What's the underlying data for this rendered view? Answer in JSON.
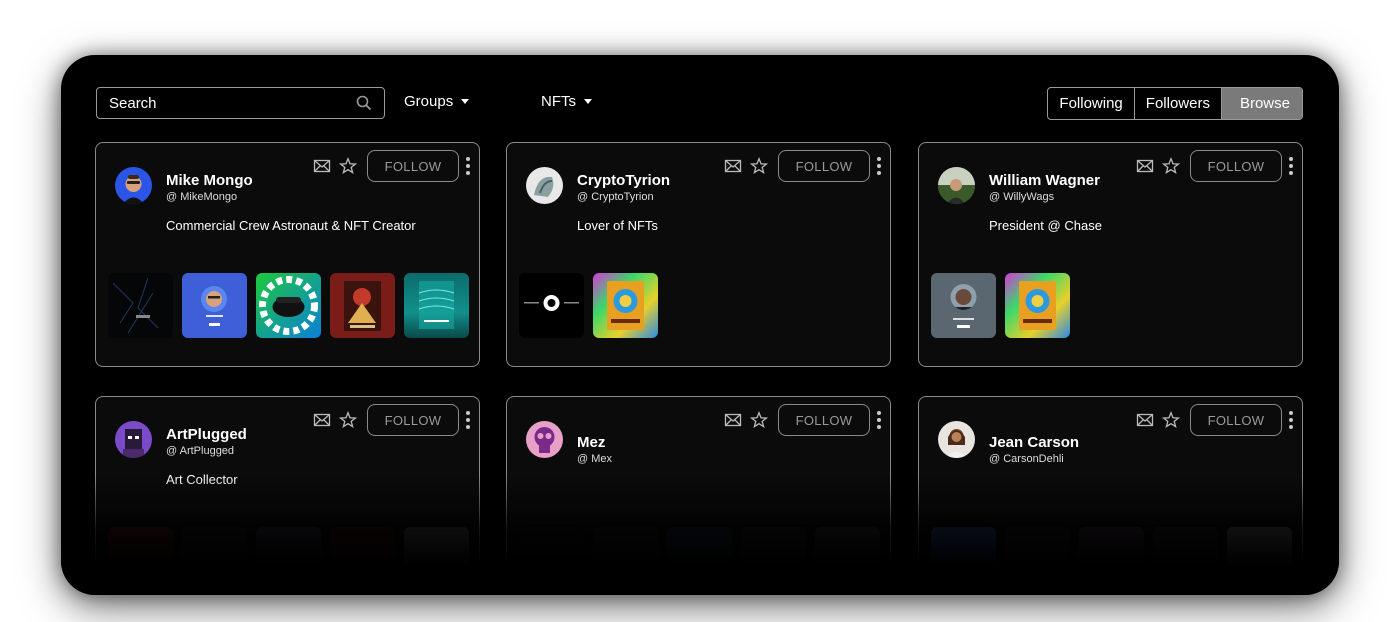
{
  "toolbar": {
    "search_placeholder": "Search",
    "groups_label": "Groups",
    "nfts_label": "NFTs",
    "tabs": [
      "Following",
      "Followers",
      "Browse"
    ],
    "active_tab": "Browse"
  },
  "follow_label": "FOLLOW",
  "cards": [
    {
      "name": "Mike Mongo",
      "handle": "@ MikeMongo",
      "bio": "Commercial Crew Astronaut & NFT Creator"
    },
    {
      "name": "CryptoTyrion",
      "handle": "@ CryptoTyrion",
      "bio": "Lover of NFTs"
    },
    {
      "name": "William Wagner",
      "handle": "@ WillyWags",
      "bio": "President @ Chase"
    },
    {
      "name": "ArtPlugged",
      "handle": "@ ArtPlugged",
      "bio": "Art Collector"
    },
    {
      "name": "Mez",
      "handle": "@ Mex",
      "bio": ""
    },
    {
      "name": "Jean Carson",
      "handle": "@ CarsonDehli",
      "bio": ""
    }
  ],
  "colors": {
    "background": "#000000",
    "card_border": "#8a8a8a",
    "active_tab": "#7a7a7a"
  }
}
